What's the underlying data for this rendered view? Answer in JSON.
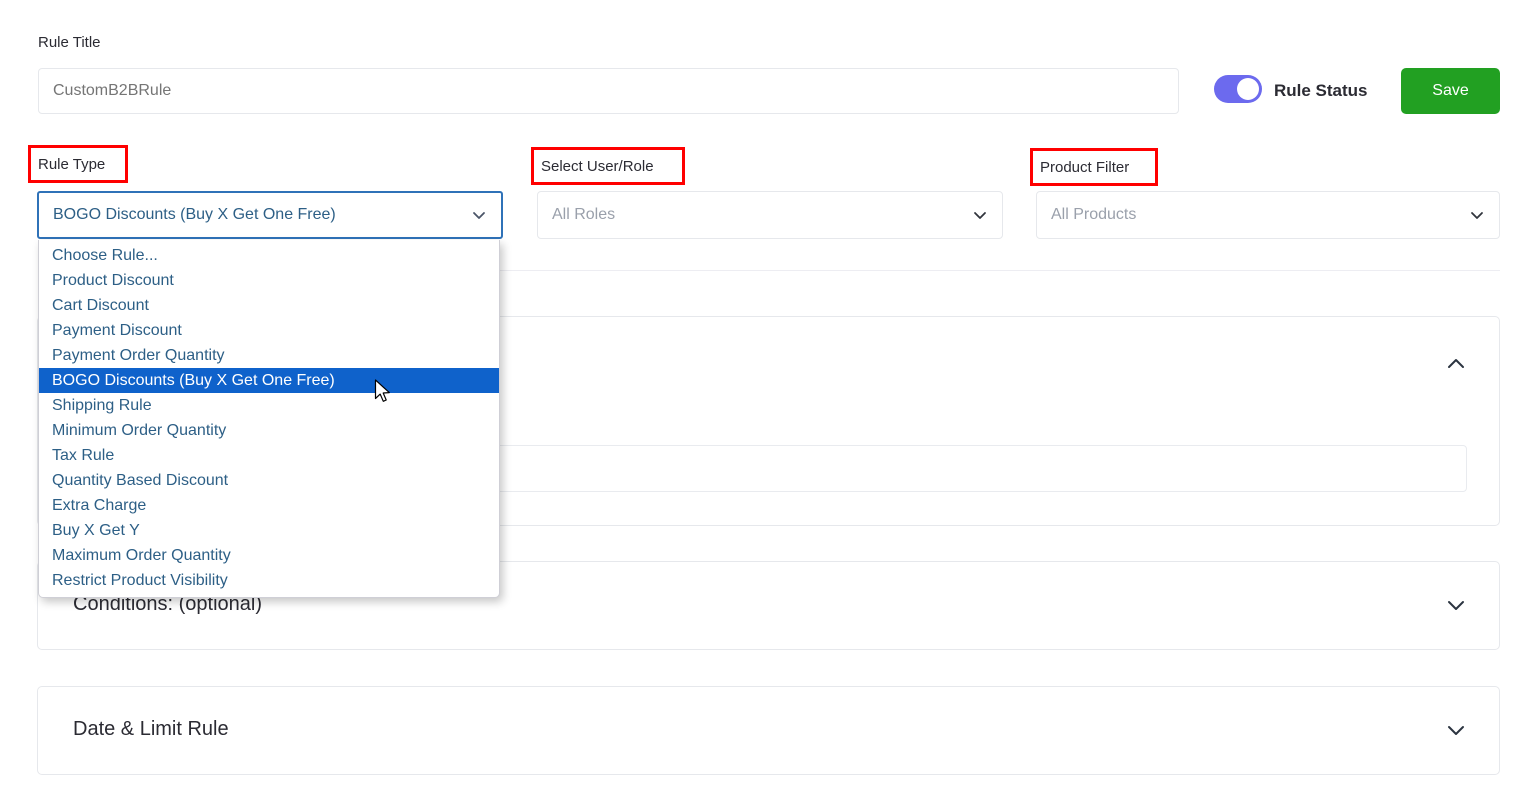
{
  "form": {
    "rule_title_label": "Rule Title",
    "rule_title_placeholder": "CustomB2BRule",
    "rule_title_value": "",
    "rule_status_label": "Rule Status",
    "rule_status_on": true,
    "save_label": "Save",
    "toggle_color": "#6c6aee",
    "save_color": "#22a022"
  },
  "selectors": {
    "rule_type": {
      "label": "Rule Type",
      "value": "BOGO Discounts (Buy X Get One Free)",
      "open": true,
      "focus_border_color": "#2f72b8",
      "options": [
        "Choose Rule...",
        "Product Discount",
        "Cart Discount",
        "Payment Discount",
        "Payment Order Quantity",
        "BOGO Discounts (Buy X Get One Free)",
        "Shipping Rule",
        "Minimum Order Quantity",
        "Tax Rule",
        "Quantity Based Discount",
        "Extra Charge",
        "Buy X Get Y",
        "Maximum Order Quantity",
        "Restrict Product Visibility"
      ],
      "selected_index": 5,
      "highlight_color": "#0f62cb"
    },
    "user_role": {
      "label": "Select User/Role",
      "value": "All Roles"
    },
    "product_filter": {
      "label": "Product Filter",
      "value": "All Products"
    }
  },
  "annotation": {
    "color": "#ff0000",
    "boxes": [
      "Rule Type",
      "Select User/Role",
      "Product Filter"
    ]
  },
  "panels": [
    {
      "title": "",
      "expanded": true,
      "chevron": "chevron-up-icon"
    },
    {
      "title": "Conditions: (optional)",
      "expanded": false,
      "chevron": "chevron-down-icon"
    },
    {
      "title": "Date & Limit Rule",
      "expanded": false,
      "chevron": "chevron-down-icon"
    }
  ]
}
